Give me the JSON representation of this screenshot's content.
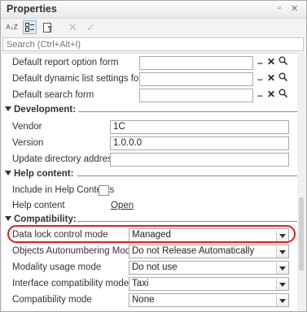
{
  "panel": {
    "title": "Properties",
    "pin_icon": "pin-icon",
    "close_icon": "close-icon"
  },
  "toolbar": {
    "sort_label": "A↓Z",
    "buttons": [
      "sort-alphabetically-icon",
      "categories-icon",
      "filter-icon",
      "clear-icon",
      "confirm-icon"
    ]
  },
  "search": {
    "placeholder": "Search (Ctrl+Alt+I)"
  },
  "rows": {
    "default_report_option_form": "Default report option form",
    "default_dynamic_list_settings_form": "Default dynamic list settings form",
    "default_search_form": "Default search form"
  },
  "development": {
    "title": "Development:",
    "vendor_label": "Vendor",
    "vendor_value": "1C",
    "version_label": "Version",
    "version_value": "1.0.0.0",
    "update_dir_label": "Update directory address",
    "update_dir_value": ""
  },
  "help_content": {
    "title": "Help content:",
    "include_label": "Include in Help Contents",
    "include_checked": false,
    "help_content_label": "Help content",
    "help_content_link": "Open"
  },
  "compatibility": {
    "title": "Compatibility:",
    "data_lock_label": "Data lock control mode",
    "data_lock_value": "Managed",
    "autonumbering_label": "Objects Autonumbering Mode",
    "autonumbering_value": "Do not Release Automatically",
    "modality_label": "Modality usage mode",
    "modality_value": "Do not use",
    "interface_label": "Interface compatibility mode",
    "interface_value": "Taxi",
    "compat_label": "Compatibility mode",
    "compat_value": "None"
  },
  "highlight_color": "#e0201b"
}
